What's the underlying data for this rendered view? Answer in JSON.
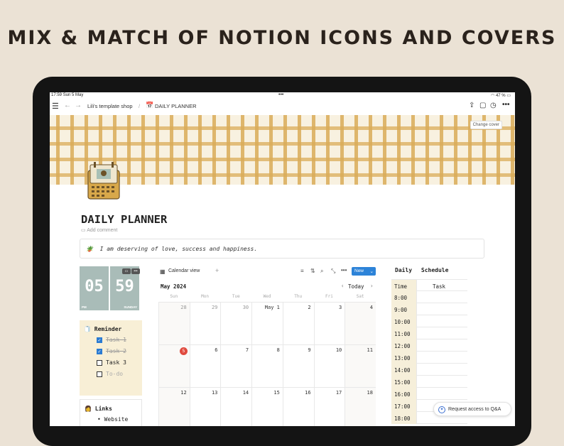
{
  "headline": "MIX & MATCH OF NOTION ICONS AND COVERS",
  "status": {
    "time": "17:59",
    "date": "Sun 5 May",
    "center": "•••",
    "battery": "47 %"
  },
  "topbar": {
    "breadcrumb_workspace": "Lili's template shop",
    "separator": "/",
    "breadcrumb_page": "DAILY PLANNER",
    "icons": [
      "menu-icon",
      "back-arrow-icon",
      "forward-arrow-icon",
      "share-icon",
      "comment-icon",
      "clock-icon",
      "more-icon"
    ]
  },
  "cover": {
    "change_cover_label": "Change cover",
    "pattern_color": "#daac58"
  },
  "page": {
    "title": "DAILY PLANNER",
    "add_comment": "Add comment",
    "quote_emoji": "🪴",
    "quote": "I am deserving of love, success and happiness."
  },
  "clock": {
    "hours": "05",
    "minutes": "59",
    "period": "PM",
    "day": "SUNDAY",
    "color": "#a9bcb8"
  },
  "reminder": {
    "emoji": "🧻",
    "title": "Reminder",
    "tasks": [
      {
        "label": "Task 1",
        "checked": true
      },
      {
        "label": "Task 2",
        "checked": true
      },
      {
        "label": "Task 3",
        "checked": false
      },
      {
        "label": "To-do",
        "checked": false
      }
    ]
  },
  "links": {
    "emoji": "👩",
    "title": "Links",
    "items": [
      "Website"
    ]
  },
  "calendar": {
    "view_label": "Calendar view",
    "add": "+",
    "new_label": "New",
    "month": "May 2024",
    "today_label": "Today",
    "weekdays": [
      "Sun",
      "Mon",
      "Tue",
      "Wed",
      "Thu",
      "Fri",
      "Sat"
    ],
    "weeks": [
      [
        "28",
        "29",
        "30",
        "May 1",
        "2",
        "3",
        "4"
      ],
      [
        "5",
        "6",
        "7",
        "8",
        "9",
        "10",
        "11"
      ],
      [
        "12",
        "13",
        "14",
        "15",
        "16",
        "17",
        "18"
      ]
    ],
    "today_date": "5",
    "accent": "#2d83d8",
    "today_color": "#e04a3e"
  },
  "schedule": {
    "title": "Daily Schedule",
    "col_time": "Time",
    "col_task": "Task",
    "times": [
      "8:00",
      "9:00",
      "10:00",
      "11:00",
      "12:00",
      "13:00",
      "14:00",
      "15:00",
      "16:00",
      "17:00",
      "18:00"
    ]
  },
  "qa_button": {
    "label": "Request access to Q&A"
  }
}
